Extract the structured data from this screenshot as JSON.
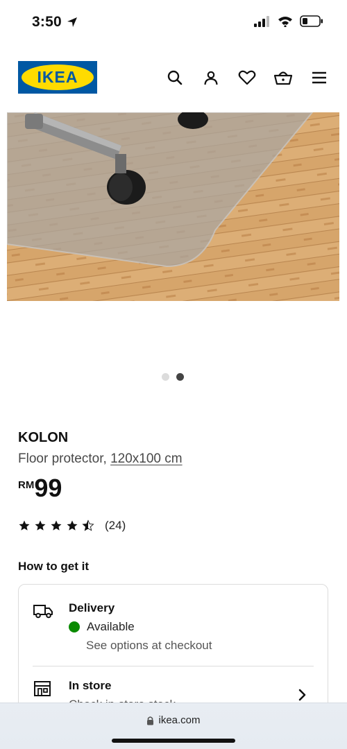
{
  "status_bar": {
    "time": "3:50"
  },
  "header": {
    "logo_text": "IKEA",
    "icons": [
      "search-icon",
      "profile-icon",
      "heart-icon",
      "basket-icon",
      "menu-icon"
    ]
  },
  "carousel": {
    "total": 2,
    "active_index": 1
  },
  "product": {
    "name": "KOLON",
    "description": "Floor protector, ",
    "size": "120x100 cm",
    "price_currency": "RM",
    "price_value": "99",
    "rating": 4.5,
    "rating_count": "(24)"
  },
  "how_to_get_it": {
    "title": "How to get it",
    "delivery": {
      "title": "Delivery",
      "status": "Available",
      "subtext": "See options at checkout"
    },
    "in_store": {
      "title": "In store",
      "subtext": "Check in-store stock"
    }
  },
  "browser": {
    "url": "ikea.com"
  },
  "colors": {
    "brand_blue": "#0058a3",
    "brand_yellow": "#ffdb00",
    "available_green": "#0a8a00"
  }
}
